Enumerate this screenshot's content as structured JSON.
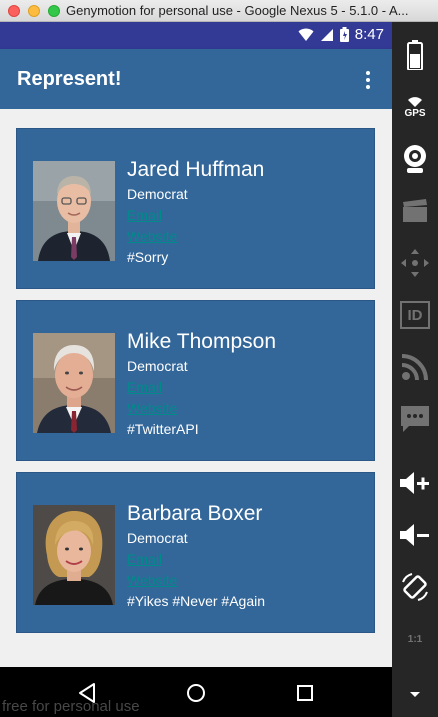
{
  "window": {
    "title": "Genymotion for personal use - Google Nexus 5 - 5.1.0 - A..."
  },
  "status_bar": {
    "time": "8:47"
  },
  "toolbar": {
    "app_title": "Represent!"
  },
  "representatives": [
    {
      "name": "Jared Huffman",
      "party": "Democrat",
      "email_label": "Email",
      "website_label": "Website",
      "tags": "#Sorry"
    },
    {
      "name": "Mike Thompson",
      "party": "Democrat",
      "email_label": "Email",
      "website_label": "Website",
      "tags": "#TwitterAPI"
    },
    {
      "name": "Barbara Boxer",
      "party": "Democrat",
      "email_label": "Email",
      "website_label": "Website",
      "tags": "#Yikes #Never #Again"
    }
  ],
  "watermark": "free for personal use",
  "side_panel": {
    "gps_label": "GPS",
    "id_label": "ID",
    "scale_label": "1:1"
  },
  "colors": {
    "toolbar": "#336699",
    "status_bar": "#333a96",
    "link": "#008b8b"
  }
}
